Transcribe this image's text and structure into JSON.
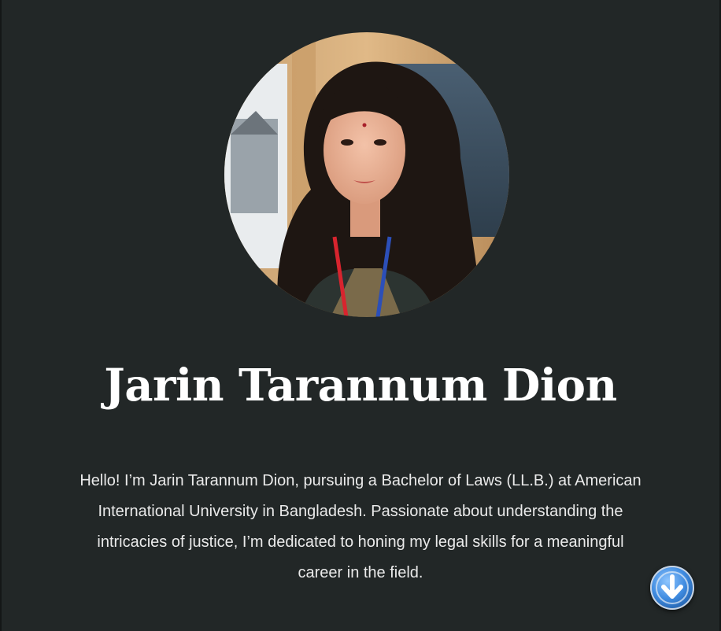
{
  "profile": {
    "name": "Jarin Tarannum Dion",
    "bio": "Hello! I’m Jarin Tarannum Dion, pursuing a Bachelor of Laws (LL.B.) at American International University in Bangladesh. Passionate about understanding the intricacies of justice, I’m dedicated to honing my legal skills for a meaningful career in the field.",
    "photo_icon": "profile-photo"
  },
  "scroll_button": {
    "icon": "arrow-down-icon"
  },
  "colors": {
    "background": "#222727",
    "text": "#ffffff",
    "accent": "#3f8be0"
  }
}
